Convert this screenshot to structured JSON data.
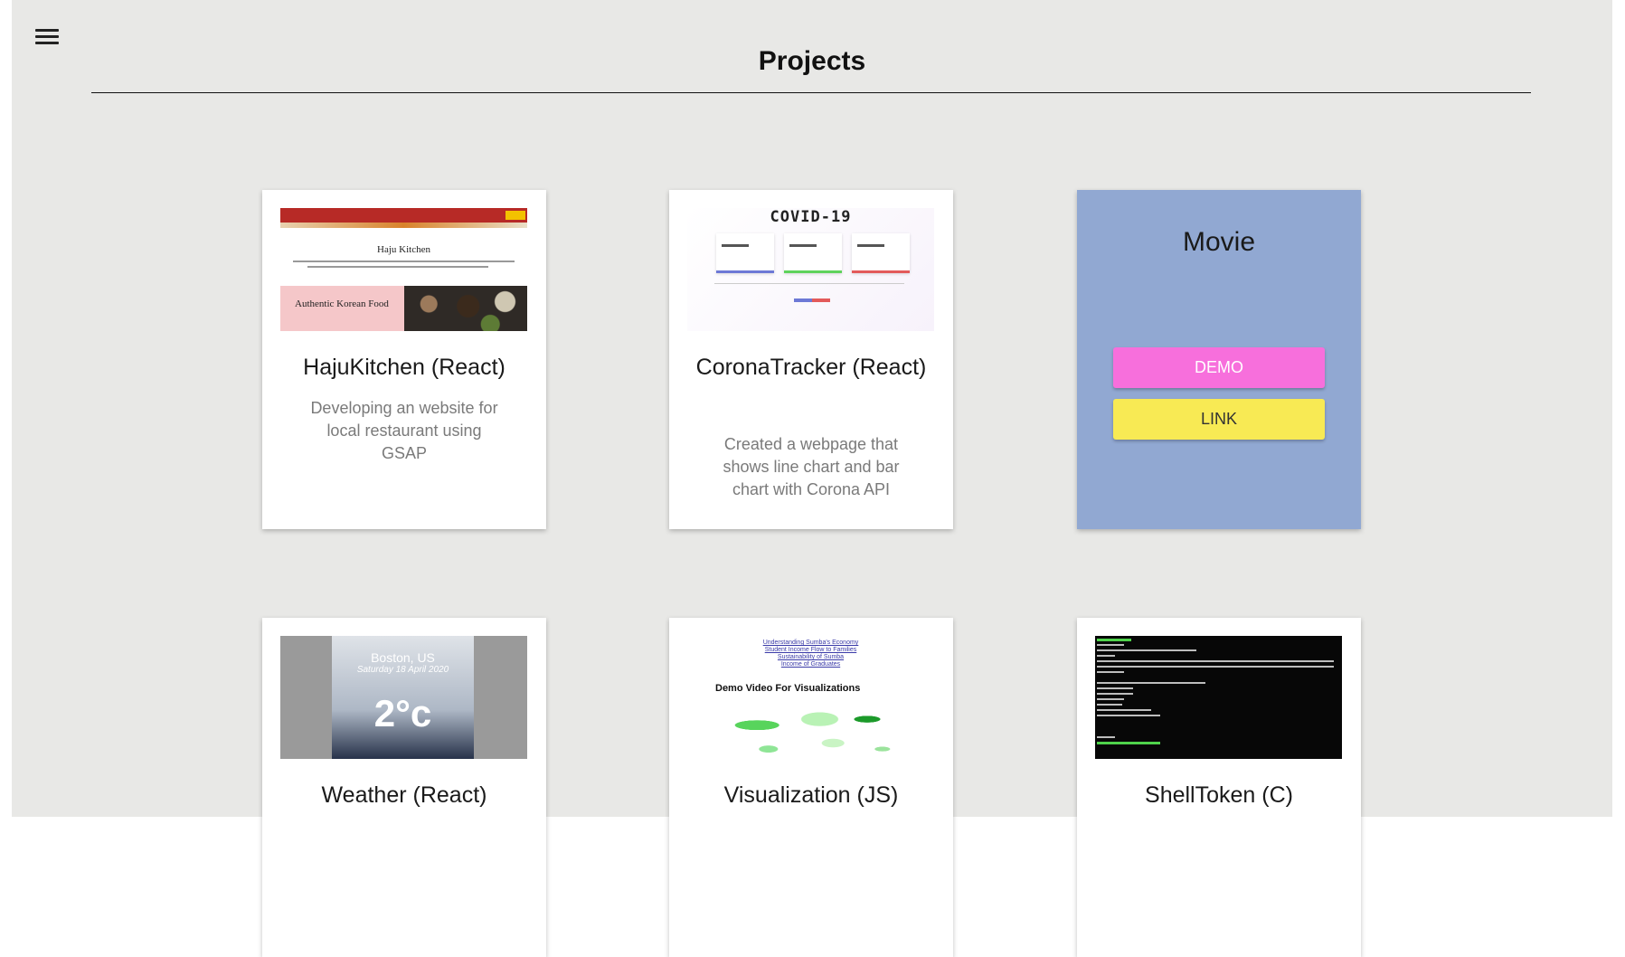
{
  "page": {
    "title": "Projects"
  },
  "nav": {
    "menu_icon": "hamburger-menu-icon"
  },
  "cards": [
    {
      "id": "haju",
      "title": "HajuKitchen (React)",
      "description": "Developing an website for local restaurant using GSAP",
      "thumb": {
        "heading": "Haju Kitchen",
        "banner": "Authentic Korean Food"
      }
    },
    {
      "id": "corona",
      "title": "CoronaTracker (React)",
      "description": "Created a webpage that shows line chart and bar chart with Corona API",
      "thumb": {
        "heading": "COVID-19"
      }
    },
    {
      "id": "movie",
      "title": "Movie",
      "demo_label": "DEMO",
      "link_label": "LINK",
      "colors": {
        "card": "#91a8d2",
        "demo": "#f76fdc",
        "link": "#f8ea54"
      }
    },
    {
      "id": "weather",
      "title": "Weather (React)",
      "thumb": {
        "city": "Boston, US",
        "date": "Saturday 18 April 2020",
        "temp": "2°c"
      }
    },
    {
      "id": "viz",
      "title": "Visualization (JS)",
      "thumb": {
        "links": [
          "Understanding Sumba's Economy",
          "Student Income Flow to Families",
          "Sustainability of Sumba",
          "Income of Graduates"
        ],
        "heading": "Demo Video For Visualizations"
      }
    },
    {
      "id": "shell",
      "title": "ShellToken (C)"
    }
  ]
}
